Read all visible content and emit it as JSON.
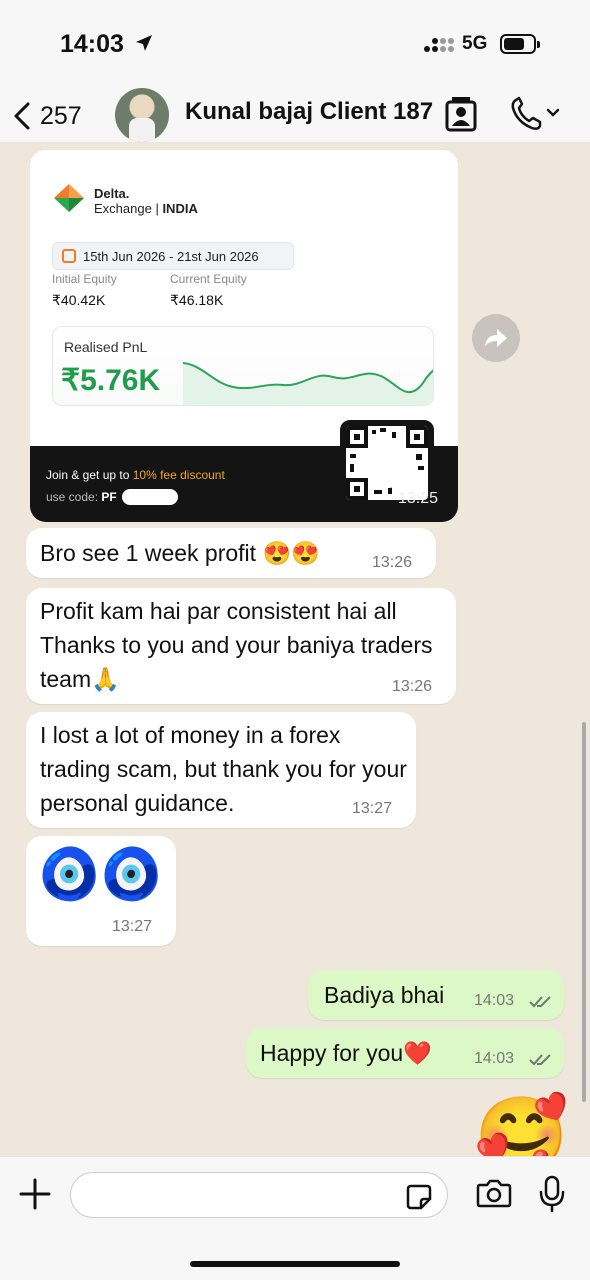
{
  "status_bar": {
    "time": "14:03",
    "network": "5G"
  },
  "header": {
    "back_count": "257",
    "contact_name": "Kunal bajaj Client 187"
  },
  "card": {
    "brand_name": "Delta.",
    "brand_sub": "Exchange",
    "brand_region": "INDIA",
    "date_range": "15th Jun 2026 - 21st Jun 2026",
    "initial_equity_label": "Initial Equity",
    "initial_equity": "₹40.42K",
    "current_equity_label": "Current Equity",
    "current_equity": "₹46.18K",
    "pnl_label": "Realised PnL",
    "pnl_value": "₹5.76K",
    "promo_text": "Join & get up to",
    "promo_highlight": "10% fee discount",
    "promo_code_label": "use code:",
    "promo_code": "PF",
    "time": "13:25"
  },
  "messages": [
    {
      "text": "Bro see 1 week profit 😍😍",
      "time": "13:26"
    },
    {
      "text": "Profit kam hai par consistent hai all Thanks to you and your baniya traders team🙏",
      "time": "13:26"
    },
    {
      "text": "I lost a lot of money in a forex trading scam, but thank you for your personal guidance.",
      "time": "13:27"
    },
    {
      "text": "🧿🧿",
      "time": "13:27"
    },
    {
      "text": "Badiya bhai",
      "time": "14:03"
    },
    {
      "text": "Happy for you❤️",
      "time": "14:03"
    },
    {
      "text": "🥰"
    }
  ]
}
